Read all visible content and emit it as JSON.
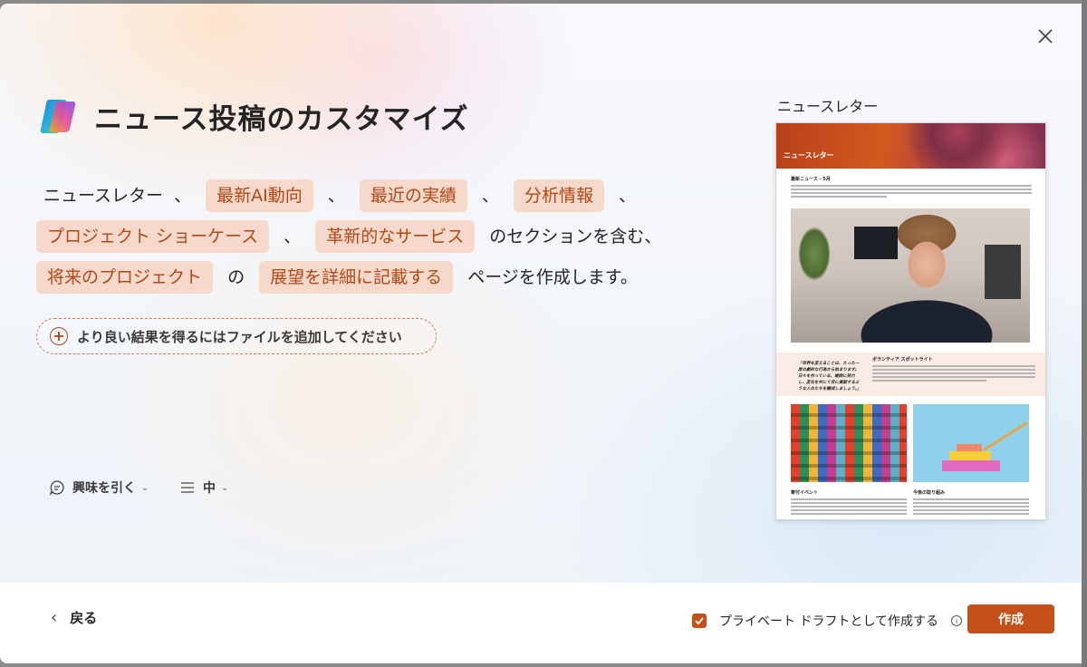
{
  "dialog": {
    "title": "ニュース投稿のカスタマイズ",
    "close_icon": "close-icon",
    "logo_icon": "copilot-logo-icon"
  },
  "prompt": {
    "p1": "ニュースレター",
    "sep": "、",
    "chip1": "最新AI動向",
    "chip2": "最近の実績",
    "chip3": "分析情報",
    "chip4": "プロジェクト ショーケース",
    "chip5": "革新的なサービス",
    "p2": "のセクションを含む、",
    "chip6": "将来のプロジェクト",
    "p3": "の",
    "chip7": "展望を詳細に記載する",
    "p4": "ページを作成します。"
  },
  "add_file": {
    "label": "より良い結果を得るにはファイルを追加してください",
    "icon": "plus-circle-icon"
  },
  "options": {
    "tone": "興味を引く",
    "tone_icon": "chat-bubble-icon",
    "length": "中",
    "length_icon": "lines-icon"
  },
  "preview": {
    "label": "ニュースレター",
    "banner_title": "ニュースレター",
    "section1": "最新ニュース - 5月",
    "quote": "「世界を変えることは、たった一度の劇的な行為から始まります。日々を作っている、継続に努力し、変化を共にて目に貢献するような人のたちを醸成しましょう。」",
    "spotlight": "ボランティア スポットライト",
    "col1_title": "寄付イベント",
    "col2_title": "今後の取り組み"
  },
  "footer": {
    "back": "戻る",
    "private_label": "プライベート ドラフトとして作成する",
    "private_checked": true,
    "create": "作成"
  },
  "colors": {
    "accent": "#c4501a",
    "chip_bg": "#f6d9cb",
    "chip_text": "#b34715"
  }
}
